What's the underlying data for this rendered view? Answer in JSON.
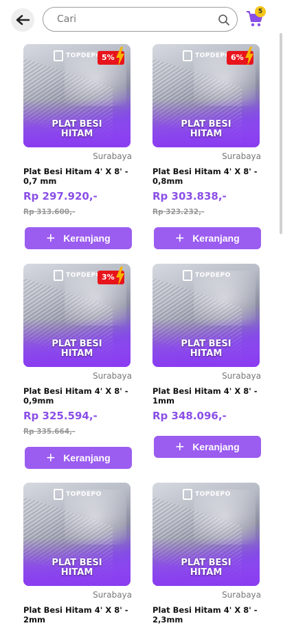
{
  "header": {
    "search_placeholder": "Cari",
    "cart_count": "5"
  },
  "icons": {
    "back": "back-arrow-icon",
    "search": "search-icon",
    "cart": "shopping-cart-icon"
  },
  "colors": {
    "accent": "#9b5cf0",
    "price": "#8a4fe6",
    "discount": "#e8141c",
    "badge": "#f5c518"
  },
  "products": [
    {
      "brand": "TOPDEPO",
      "image_title_1": "PLAT BESI",
      "image_title_2": "HITAM",
      "discount": "5%",
      "city": "Surabaya",
      "name": "Plat Besi Hitam 4' X 8' - 0,7 mm",
      "price": "Rp 297.920,-",
      "original_price": "Rp 313.600,-",
      "button": "Keranjang"
    },
    {
      "brand": "TOPDEPO",
      "image_title_1": "PLAT BESI",
      "image_title_2": "HITAM",
      "discount": "6%",
      "city": "Surabaya",
      "name": "Plat Besi Hitam 4' X 8' - 0,8mm",
      "price": "Rp 303.838,-",
      "original_price": "Rp 323.232,-",
      "button": "Keranjang"
    },
    {
      "brand": "TOPDEPO",
      "image_title_1": "PLAT BESI",
      "image_title_2": "HITAM",
      "discount": "3%",
      "city": "Surabaya",
      "name": "Plat Besi Hitam 4' X 8' - 0,9mm",
      "price": "Rp 325.594,-",
      "original_price": "Rp 335.664,-",
      "button": "Keranjang"
    },
    {
      "brand": "TOPDEPO",
      "image_title_1": "PLAT BESI",
      "image_title_2": "HITAM",
      "discount": "",
      "city": "Surabaya",
      "name": "Plat Besi Hitam 4' X 8' - 1mm",
      "price": "Rp 348.096,-",
      "original_price": "",
      "button": "Keranjang"
    },
    {
      "brand": "TOPDEPO",
      "image_title_1": "PLAT BESI",
      "image_title_2": "HITAM",
      "discount": "",
      "city": "Surabaya",
      "name": "Plat Besi Hitam 4' X 8' - 2mm",
      "price": "",
      "original_price": "",
      "button": ""
    },
    {
      "brand": "TOPDEPO",
      "image_title_1": "PLAT BESI",
      "image_title_2": "HITAM",
      "discount": "",
      "city": "Surabaya",
      "name": "Plat Besi Hitam 4' X 8' - 2,3mm",
      "price": "",
      "original_price": "",
      "button": ""
    }
  ]
}
